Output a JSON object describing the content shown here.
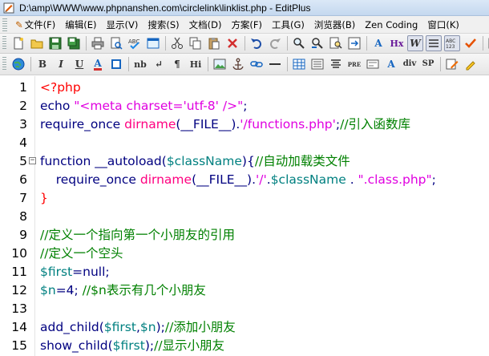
{
  "window": {
    "title": "D:\\amp\\WWW\\www.phpnanshen.com\\circlelink\\linklist.php - EditPlus"
  },
  "menu": [
    {
      "label": "文件(F)"
    },
    {
      "label": "编辑(E)"
    },
    {
      "label": "显示(V)"
    },
    {
      "label": "搜索(S)"
    },
    {
      "label": "文档(D)"
    },
    {
      "label": "方案(F)"
    },
    {
      "label": "工具(G)"
    },
    {
      "label": "浏览器(B)"
    },
    {
      "label": "Zen Coding"
    },
    {
      "label": "窗口(K)"
    }
  ],
  "toolbar2_text": {
    "bold": "B",
    "italic": "I",
    "underline": "U",
    "font_color": "A",
    "nbsp": "nb",
    "br": "↵",
    "para": "¶",
    "heading": "Hi",
    "pre": "PRE",
    "font": "A",
    "div": "div",
    "span": "SP"
  },
  "toolbar1_text": {
    "font_size": "A",
    "hex": "Hx",
    "wordwrap": "W",
    "abc": "ABC",
    "ruler": "123"
  },
  "editor": {
    "lines": [
      {
        "n": "1",
        "segments": [
          {
            "t": "<?php",
            "c": "c-tag"
          }
        ]
      },
      {
        "n": "2",
        "segments": [
          {
            "t": "echo ",
            "c": "c-kw"
          },
          {
            "t": "\"<meta charset='utf-8' />\"",
            "c": "c-str"
          },
          {
            "t": ";",
            "c": "c-op"
          }
        ]
      },
      {
        "n": "3",
        "segments": [
          {
            "t": "require_once ",
            "c": "c-kw"
          },
          {
            "t": "dirname",
            "c": "c-fn"
          },
          {
            "t": "(__FILE__).",
            "c": "c-const"
          },
          {
            "t": "'/functions.php'",
            "c": "c-str"
          },
          {
            "t": ";",
            "c": "c-op"
          },
          {
            "t": "//引入函数库",
            "c": "c-cmt"
          }
        ]
      },
      {
        "n": "4",
        "segments": []
      },
      {
        "n": "5",
        "fold": true,
        "segments": [
          {
            "t": "function ",
            "c": "c-kw"
          },
          {
            "t": "__autoload(",
            "c": "c-kw"
          },
          {
            "t": "$className",
            "c": "c-var"
          },
          {
            "t": "){",
            "c": "c-op"
          },
          {
            "t": "//自动加载类文件",
            "c": "c-cmt"
          }
        ]
      },
      {
        "n": "6",
        "segments": [
          {
            "t": "    require_once ",
            "c": "c-kw"
          },
          {
            "t": "dirname",
            "c": "c-fn"
          },
          {
            "t": "(__FILE__).",
            "c": "c-const"
          },
          {
            "t": "'/'",
            "c": "c-str"
          },
          {
            "t": ".",
            "c": "c-op"
          },
          {
            "t": "$className",
            "c": "c-var"
          },
          {
            "t": " . ",
            "c": "c-op"
          },
          {
            "t": "\".class.php\"",
            "c": "c-str"
          },
          {
            "t": ";",
            "c": "c-op"
          }
        ]
      },
      {
        "n": "7",
        "segments": [
          {
            "t": "}",
            "c": "c-tag"
          }
        ]
      },
      {
        "n": "8",
        "segments": []
      },
      {
        "n": "9",
        "segments": [
          {
            "t": "//定义一个指向第一个小朋友的引用",
            "c": "c-cmt"
          }
        ]
      },
      {
        "n": "10",
        "segments": [
          {
            "t": "//定义一个空头",
            "c": "c-cmt"
          }
        ]
      },
      {
        "n": "11",
        "segments": [
          {
            "t": "$first",
            "c": "c-var"
          },
          {
            "t": "=null;",
            "c": "c-op"
          }
        ]
      },
      {
        "n": "12",
        "segments": [
          {
            "t": "$n",
            "c": "c-var"
          },
          {
            "t": "=4; ",
            "c": "c-op"
          },
          {
            "t": "//$n表示有几个小朋友",
            "c": "c-cmt"
          }
        ]
      },
      {
        "n": "13",
        "segments": []
      },
      {
        "n": "14",
        "segments": [
          {
            "t": "add_child(",
            "c": "c-kw"
          },
          {
            "t": "$first",
            "c": "c-var"
          },
          {
            "t": ",",
            "c": "c-op"
          },
          {
            "t": "$n",
            "c": "c-var"
          },
          {
            "t": ");",
            "c": "c-op"
          },
          {
            "t": "//添加小朋友",
            "c": "c-cmt"
          }
        ]
      },
      {
        "n": "15",
        "segments": [
          {
            "t": "show_child(",
            "c": "c-kw"
          },
          {
            "t": "$first",
            "c": "c-var"
          },
          {
            "t": ");",
            "c": "c-op"
          },
          {
            "t": "//显示小朋友",
            "c": "c-cmt"
          }
        ]
      }
    ]
  }
}
